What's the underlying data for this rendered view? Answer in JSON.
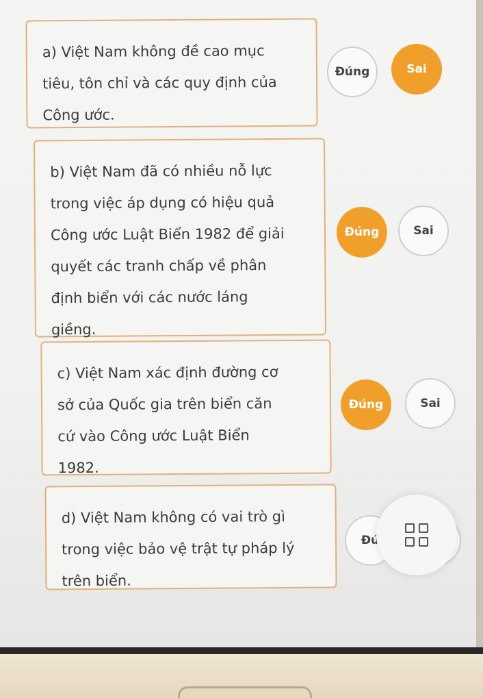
{
  "questions": [
    {
      "text": "a) Việt Nam không đề cao mục\ntiêu, tôn chỉ và các quy định của\nCông ước.",
      "true_label": "Đúng",
      "false_label": "Sai",
      "selected": "false"
    },
    {
      "text": "b) Việt Nam đã có nhiều nỗ lực\ntrong việc áp dụng có hiệu quả\nCông ước Luật Biển 1982 để giải\nquyết các tranh chấp về phân\nđịnh biển với các nước láng\ngiềng.",
      "true_label": "Đúng",
      "false_label": "Sai",
      "selected": "true"
    },
    {
      "text": "c) Việt Nam xác định đường cơ\nsở của Quốc gia trên biển căn\ncứ vào Công ước Luật Biển\n1982.",
      "true_label": "Đúng",
      "false_label": "Sai",
      "selected": "true"
    },
    {
      "text": "d) Việt Nam không có vai trò gì\ntrong việc bảo vệ trật tự pháp lý\ntrên biển.",
      "true_label": "Đú",
      "false_label": "",
      "selected": "none"
    }
  ],
  "overlay": {
    "icon": "grid-icon"
  },
  "colors": {
    "accent": "#f0a02a",
    "card_border": "#e3b07d",
    "text": "#3b3b3b"
  }
}
